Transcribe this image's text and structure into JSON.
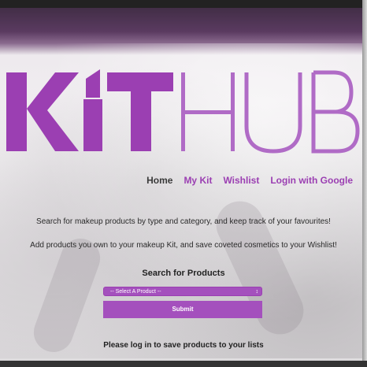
{
  "brand": {
    "logo_text_bold": "KIT",
    "logo_text_light": "HUB",
    "accent_color": "#9b3fb2",
    "button_color": "#a450bd"
  },
  "nav": {
    "home": "Home",
    "my_kit": "My Kit",
    "wishlist": "Wishlist",
    "login": "Login with Google"
  },
  "intro": {
    "line1": "Search for makeup products by type and category, and keep track of your favourites!",
    "line2": "Add products you own to your makeup Kit, and save coveted cosmetics to your Wishlist!"
  },
  "search": {
    "title": "Search for Products",
    "select_value": "-- Select A Product --",
    "submit_label": "Submit"
  },
  "footer_note": "Please log in to save products to your lists"
}
